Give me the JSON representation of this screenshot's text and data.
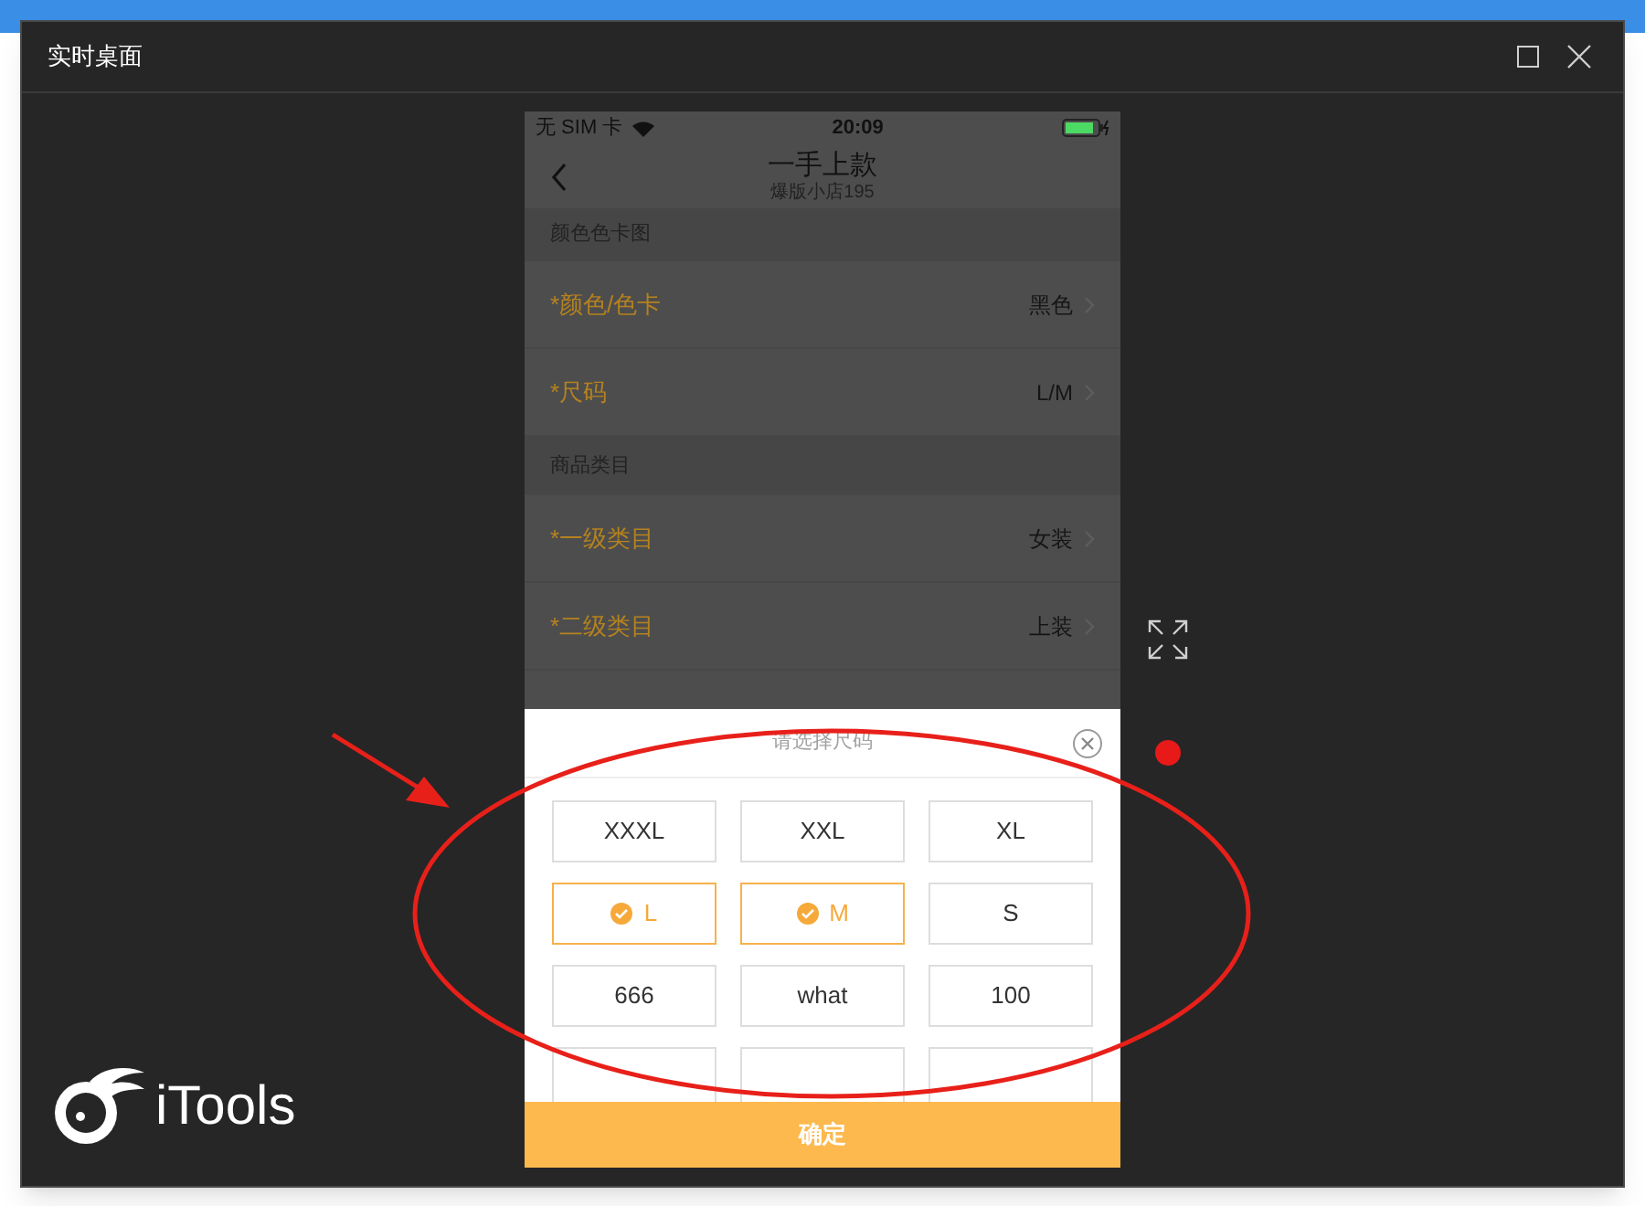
{
  "window": {
    "title": "实时桌面"
  },
  "phone": {
    "status_bar": {
      "carrier": "无 SIM 卡",
      "time": "20:09"
    },
    "nav": {
      "title": "一手上款",
      "subtitle": "爆版小店195"
    },
    "form": [
      {
        "kind": "section",
        "label": "颜色色卡图"
      },
      {
        "kind": "row",
        "label": "*颜色/色卡",
        "value": "黑色"
      },
      {
        "kind": "row",
        "label": "*尺码",
        "value": "L/M"
      },
      {
        "kind": "section",
        "label": "商品类目"
      },
      {
        "kind": "row",
        "label": "*一级类目",
        "value": "女装"
      },
      {
        "kind": "row",
        "label": "*二级类目",
        "value": "上装"
      }
    ],
    "size_picker": {
      "title": "请选择尺码",
      "options": [
        {
          "label": "XXXL",
          "selected": false
        },
        {
          "label": "XXL",
          "selected": false
        },
        {
          "label": "XL",
          "selected": false
        },
        {
          "label": "L",
          "selected": true
        },
        {
          "label": "M",
          "selected": true
        },
        {
          "label": "S",
          "selected": false
        },
        {
          "label": "666",
          "selected": false
        },
        {
          "label": "what",
          "selected": false
        },
        {
          "label": "100",
          "selected": false
        }
      ],
      "confirm": "确定"
    }
  },
  "logo": {
    "text": "iTools"
  }
}
